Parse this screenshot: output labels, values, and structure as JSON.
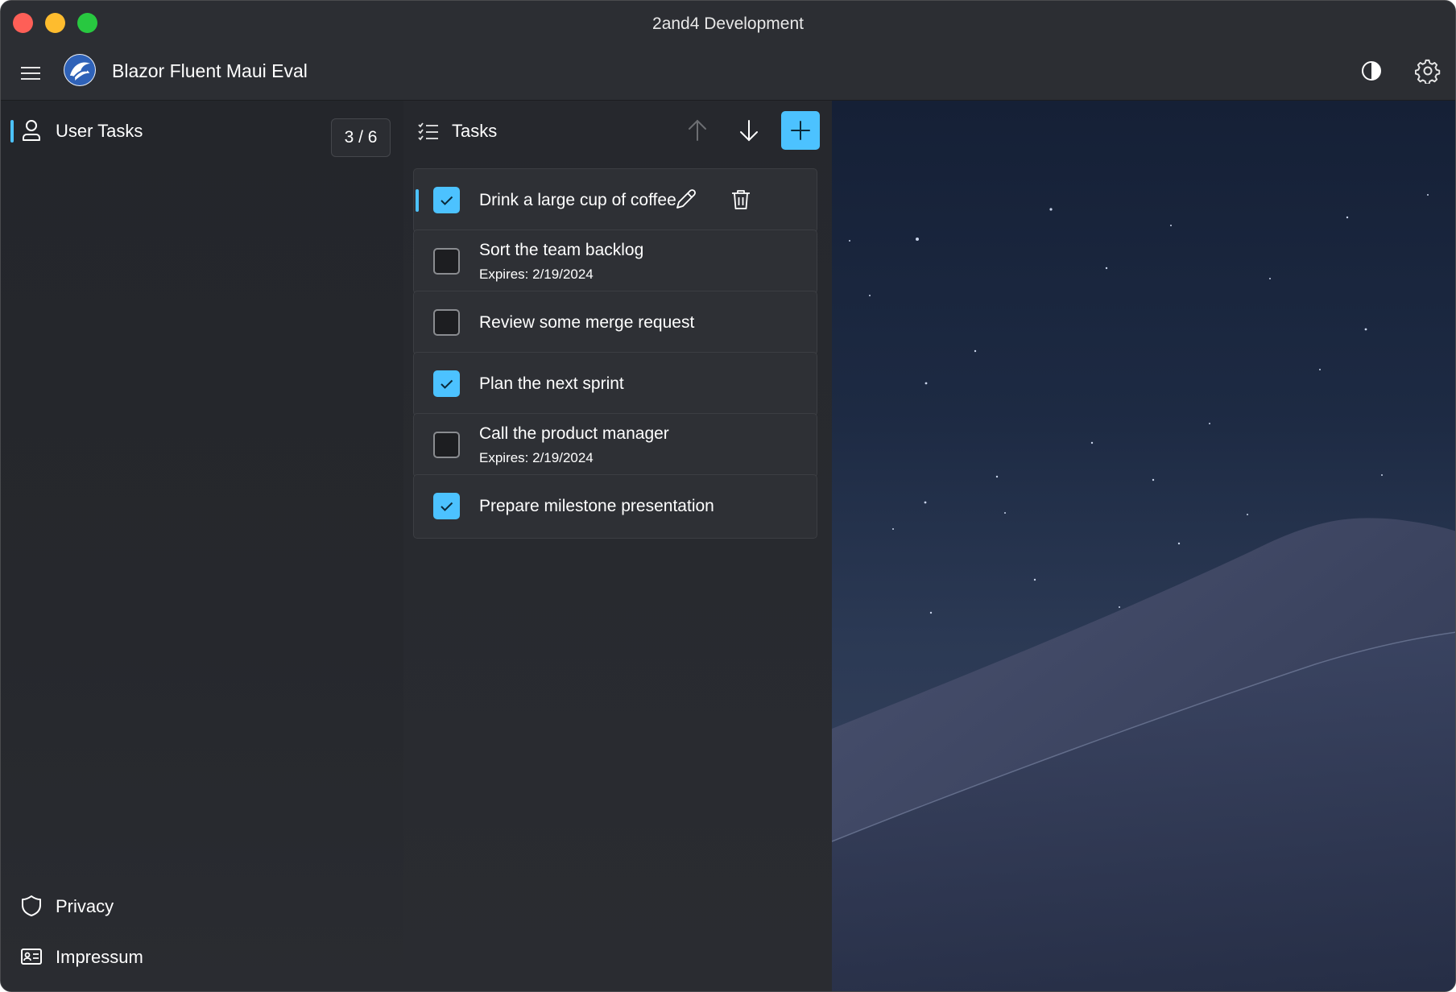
{
  "window": {
    "title": "2and4 Development"
  },
  "header": {
    "app_title": "Blazor Fluent Maui Eval",
    "menu_icon": "hamburger-menu-icon",
    "logo_icon": "app-logo-icon",
    "contrast_icon": "contrast-icon",
    "settings_icon": "gear-icon"
  },
  "sidebar": {
    "items": [
      {
        "label": "User Tasks",
        "icon": "person-icon",
        "badge": "3 / 6",
        "active": true
      },
      {
        "label": "Privacy",
        "icon": "shield-icon"
      },
      {
        "label": "Impressum",
        "icon": "contact-card-icon"
      }
    ]
  },
  "tasks": {
    "title": "Tasks",
    "icon": "checklist-icon",
    "toolbar": {
      "up_icon": "arrow-up-icon",
      "down_icon": "arrow-down-icon",
      "add_icon": "plus-icon"
    },
    "items": [
      {
        "label": "Drink a large cup of coffee",
        "expires": "",
        "done": true,
        "selected": true
      },
      {
        "label": "Sort the team backlog",
        "expires": "Expires: 2/19/2024",
        "done": false
      },
      {
        "label": "Review some merge request",
        "expires": "",
        "done": false
      },
      {
        "label": "Plan the next sprint",
        "expires": "",
        "done": true
      },
      {
        "label": "Call the product manager",
        "expires": "Expires: 2/19/2024",
        "done": false
      },
      {
        "label": "Prepare milestone presentation",
        "expires": "",
        "done": true
      }
    ]
  },
  "colors": {
    "accent": "#4cc2ff",
    "background": "#272a30",
    "text": "#ffffff"
  }
}
